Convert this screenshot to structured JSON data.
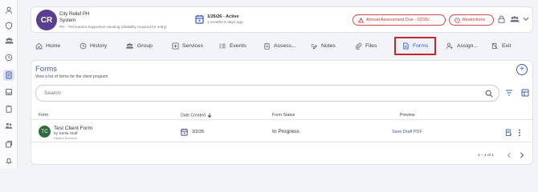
{
  "client": {
    "initials": "CR",
    "name": "City Relief PH",
    "subtitle": "System",
    "program": "PH – Permanent Supportive Housing (disability required for entry)",
    "status_title": "1/26/26 - Active",
    "status_sub": "1 months 8 days ago",
    "alert_label": "Annual Assessment Due - 02/26/...",
    "restrictions_label": "Restrictions",
    "accent": "#5a3e8f"
  },
  "tabs": {
    "home": "Home",
    "history": "History",
    "group": "Group",
    "services": "Services",
    "events": "Events",
    "assessments": "Assess...",
    "notes": "Notes",
    "files": "Files",
    "forms": "Forms",
    "assign": "Assign...",
    "exit": "Exit"
  },
  "forms": {
    "title": "Forms",
    "subtitle": "View a list of forms for the client program",
    "search_placeholder": "Search",
    "columns": {
      "form": "Form",
      "date_created": "Date Created",
      "status": "Form Status",
      "preview": "Preview"
    },
    "rows": [
      {
        "initials": "TC",
        "name": "Test Client Form",
        "by": "by Stella Staff",
        "program": "Helpful Services",
        "date": "3/2/26",
        "status": "In Progress",
        "preview": "Save Draft PDF"
      }
    ],
    "pagination": "1 – 1 of 1"
  },
  "colors": {
    "brand": "#3b5bb4",
    "alert": "#c43737",
    "highlight_border": "#c62828"
  }
}
